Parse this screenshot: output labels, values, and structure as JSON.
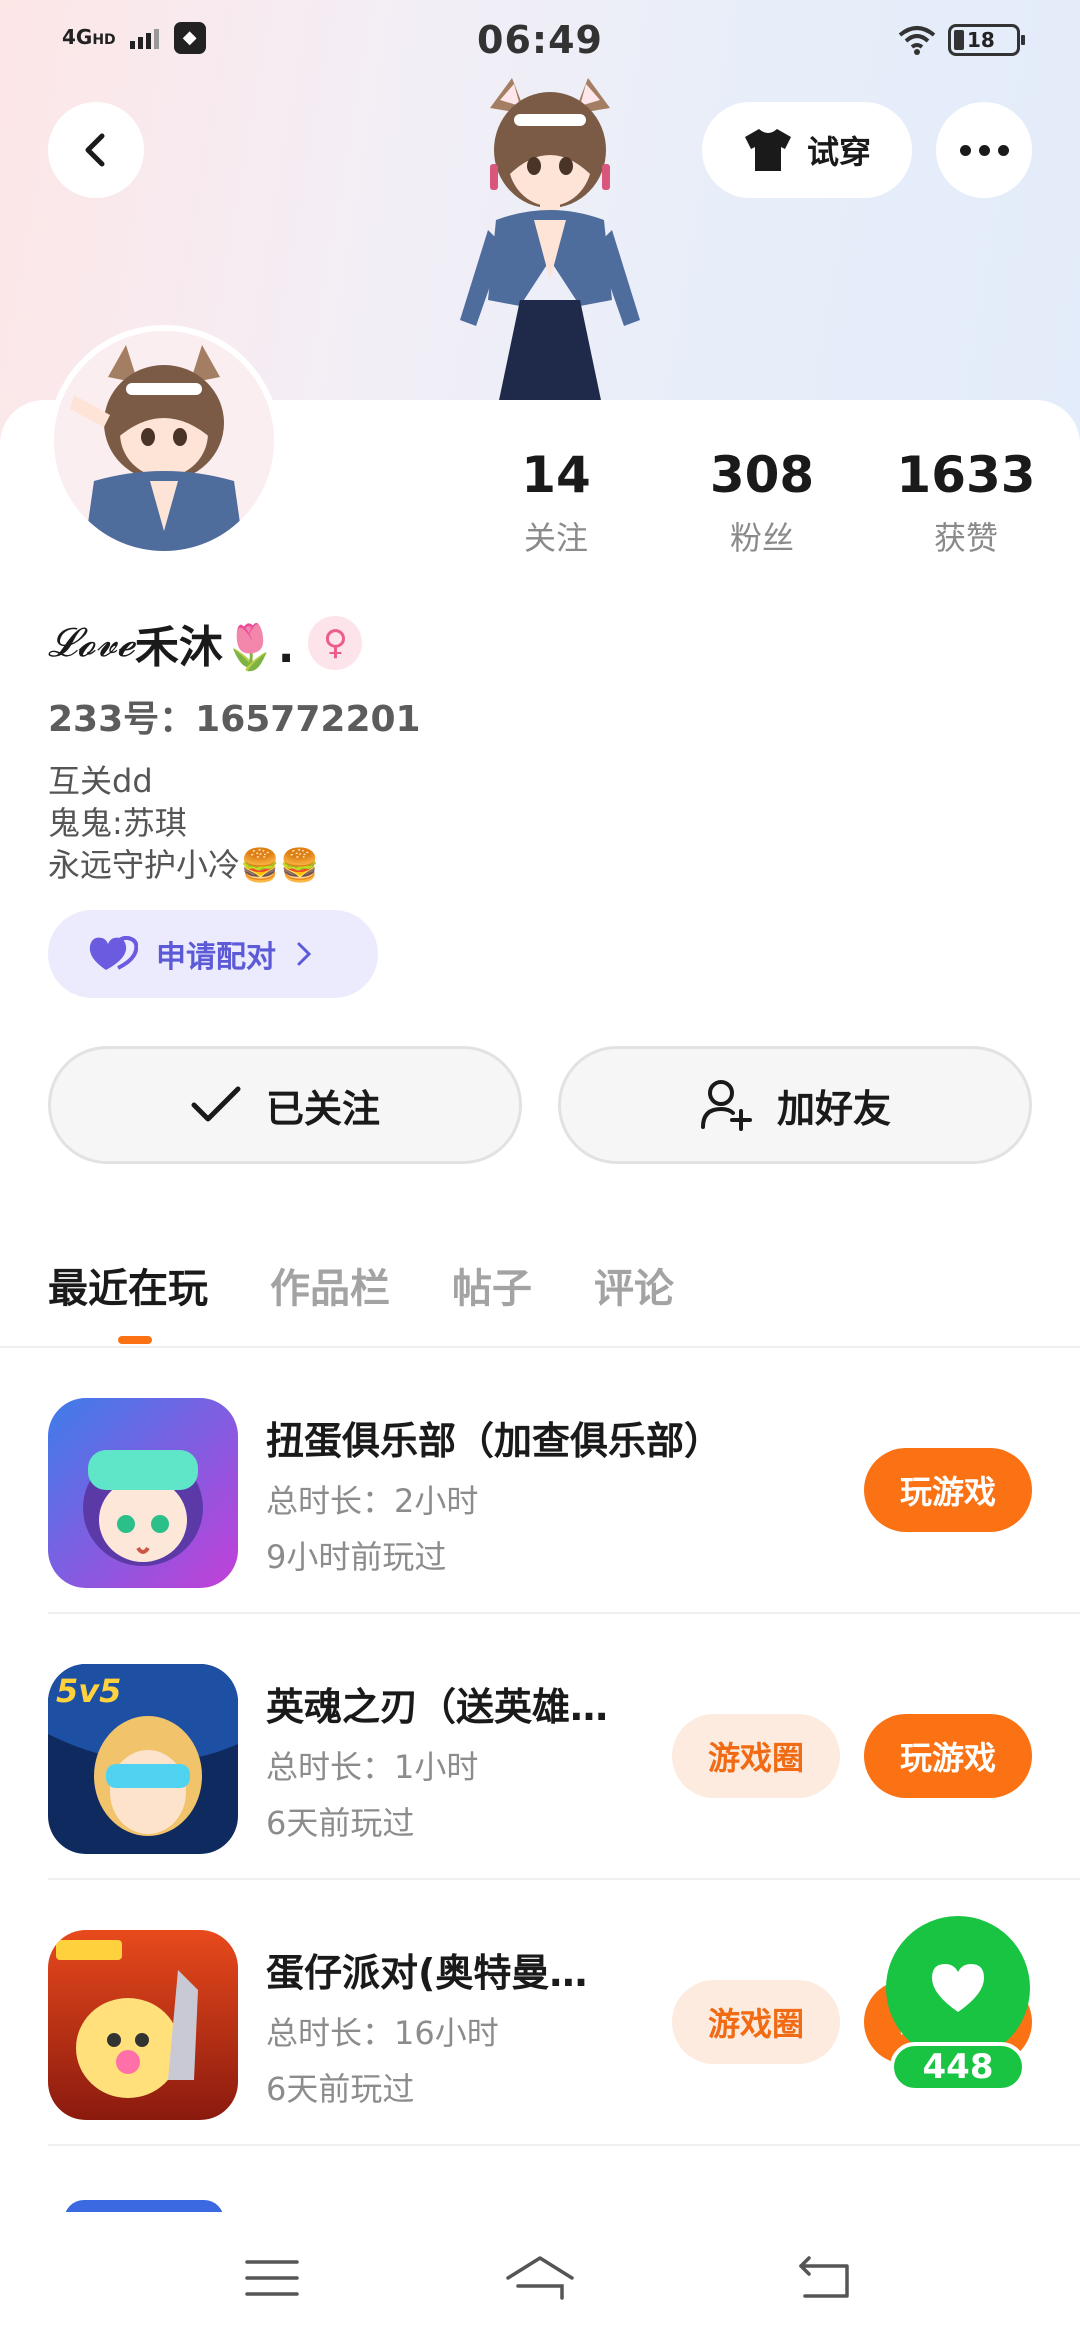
{
  "status_bar": {
    "network": "4G",
    "network_sub": "HD",
    "time": "06:49",
    "battery": "18"
  },
  "header": {
    "back_icon": "chevron-left-icon",
    "tryon_label": "试穿",
    "tryon_icon": "tshirt-icon",
    "more_icon": "more-dots-icon"
  },
  "profile": {
    "nickname_script": "𝓛𝓸𝓿𝓮",
    "nickname_text": "禾沐🌷.",
    "gender_symbol": "♀",
    "uid": "233号：165772201",
    "bio": [
      "互关dd",
      "鬼鬼:苏琪",
      "永远守护小冷🍔🍔"
    ],
    "pair_label": "申请配对",
    "stats": [
      {
        "value": "14",
        "label": "关注"
      },
      {
        "value": "308",
        "label": "粉丝"
      },
      {
        "value": "1633",
        "label": "获赞"
      }
    ],
    "followed_label": "已关注",
    "add_friend_label": "加好友"
  },
  "tabs": [
    "最近在玩",
    "作品栏",
    "帖子",
    "评论"
  ],
  "active_tab": 0,
  "games": [
    {
      "name": "扭蛋俱乐部（加查俱乐部）",
      "duration": "总时长：2小时",
      "last_played": "9小时前玩过",
      "play_label": "玩游戏",
      "circle_label": ""
    },
    {
      "name": "英魂之刃（送英雄…",
      "duration": "总时长：1小时",
      "last_played": "6天前玩过",
      "play_label": "玩游戏",
      "circle_label": "游戏圈"
    },
    {
      "name": "蛋仔派对(奥特曼…",
      "duration": "总时长：16小时",
      "last_played": "6天前玩过",
      "play_label": "玩游戏",
      "circle_label": "游戏圈"
    }
  ],
  "floating_like": {
    "count": "448",
    "icon": "heart-icon"
  },
  "colors": {
    "accent": "#fa7214",
    "green": "#19c443",
    "purple": "#5d5ad8"
  },
  "nav": {
    "menu_icon": "menu-icon",
    "home_icon": "home-icon",
    "back_icon": "back-icon"
  }
}
